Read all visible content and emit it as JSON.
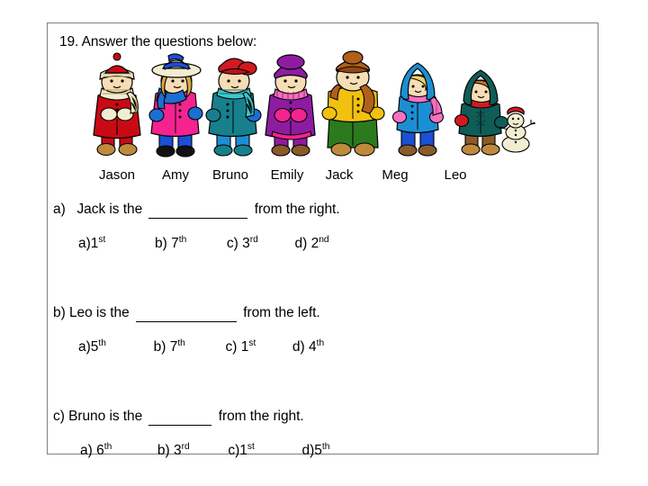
{
  "worksheet": {
    "question_number_text": "19. Answer the questions below:"
  },
  "figures": {
    "names": [
      {
        "label": "Jason",
        "coat_color": "#c90a14",
        "hat_color": "#c90a14",
        "scarf": "striped-cream"
      },
      {
        "label": "Amy",
        "coat_color": "#f4238f",
        "hat_color": "#f2ecd0",
        "scarf": "blue"
      },
      {
        "label": "Bruno",
        "coat_color": "#17808c",
        "hat_color": "#d21a22",
        "scarf": "striped-teal"
      },
      {
        "label": "Emily",
        "coat_color": "#8e1ca0",
        "hat_color": "#8e1ca0",
        "scarf": "pink"
      },
      {
        "label": "Jack",
        "coat_color": "#f2c110",
        "hat_color": "#b0601a",
        "scarf": "brown"
      },
      {
        "label": "Meg",
        "coat_color": "#1b8fd4",
        "hat_color": "#1b8fd4",
        "scarf": "pink"
      },
      {
        "label": "Leo",
        "coat_color": "#0f5d57",
        "hat_color": "#0f5d57",
        "scarf": "red"
      }
    ],
    "snowman_label": "snowman"
  },
  "questions": [
    {
      "id": "a",
      "prefix": "a)",
      "text_before": "Jack is the",
      "text_after": "from the right.",
      "blank_width": 110,
      "options": [
        {
          "label": "a)",
          "number": "1",
          "ordinal": "st",
          "space": false
        },
        {
          "label": "b)",
          "number": "7",
          "ordinal": "th",
          "space": true
        },
        {
          "label": "c)",
          "number": "3",
          "ordinal": "rd",
          "space": true
        },
        {
          "label": "d)",
          "number": "2",
          "ordinal": "nd",
          "space": true
        }
      ]
    },
    {
      "id": "b",
      "prefix": "b)",
      "text_before": "Leo is the",
      "text_after": "from the left.",
      "blank_width": 110,
      "options": [
        {
          "label": "a)",
          "number": "5",
          "ordinal": "th",
          "space": false
        },
        {
          "label": "b)",
          "number": "7",
          "ordinal": "th",
          "space": true
        },
        {
          "label": "c)",
          "number": "1",
          "ordinal": "st",
          "space": true
        },
        {
          "label": "d)",
          "number": "4",
          "ordinal": "th",
          "space": true
        }
      ]
    },
    {
      "id": "c",
      "prefix": "c)",
      "text_before": "Bruno is the",
      "text_after": "from the right.",
      "blank_width": 70,
      "options": [
        {
          "label": "a)",
          "number": "6",
          "ordinal": "th",
          "space": true
        },
        {
          "label": "b)",
          "number": "3",
          "ordinal": "rd",
          "space": true
        },
        {
          "label": "c)",
          "number": "1",
          "ordinal": "st",
          "space": false
        },
        {
          "label": "d)",
          "number": "5",
          "ordinal": "th",
          "space": false
        }
      ]
    }
  ]
}
